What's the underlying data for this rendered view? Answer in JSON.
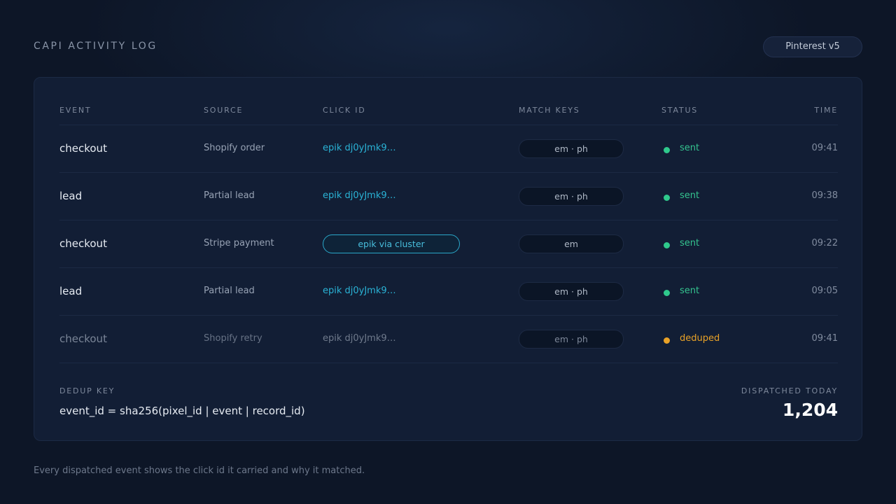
{
  "header": {
    "title": "CAPI ACTIVITY LOG",
    "platform_badge": "Pinterest v5"
  },
  "table": {
    "columns": {
      "event": "EVENT",
      "source": "SOURCE",
      "click_id": "CLICK ID",
      "match_keys": "MATCH KEYS",
      "status": "STATUS",
      "time": "TIME"
    },
    "rows": [
      {
        "event": "checkout",
        "source": "Shopify order",
        "click_id": "epik dj0yJmk9…",
        "match_keys": "em · ph",
        "status": "sent",
        "time": "09:41"
      },
      {
        "event": "lead",
        "source": "Partial lead",
        "click_id": "epik dj0yJmk9…",
        "match_keys": "em · ph",
        "status": "sent",
        "time": "09:38"
      },
      {
        "event": "checkout",
        "source": "Stripe payment",
        "click_id": "epik via cluster",
        "match_keys": "em",
        "status": "sent",
        "time": "09:22"
      },
      {
        "event": "lead",
        "source": "Partial lead",
        "click_id": "epik dj0yJmk9…",
        "match_keys": "em · ph",
        "status": "sent",
        "time": "09:05"
      },
      {
        "event": "checkout",
        "source": "Shopify retry",
        "click_id": "epik dj0yJmk9…",
        "match_keys": "em · ph",
        "status": "deduped",
        "time": "09:41"
      }
    ]
  },
  "summary": {
    "dedup_label": "DEDUP KEY",
    "dedup_value": "event_id = sha256(pixel_id | event | record_id)",
    "dispatched_label": "DISPATCHED TODAY",
    "dispatched_value": "1,204"
  },
  "footer": {
    "note": "Every dispatched event shows the click id it carried and why it matched."
  },
  "colors": {
    "status_sent": "#34c38f",
    "status_deduped": "#e9a227",
    "click_id_accent": "#2ab3d6"
  }
}
